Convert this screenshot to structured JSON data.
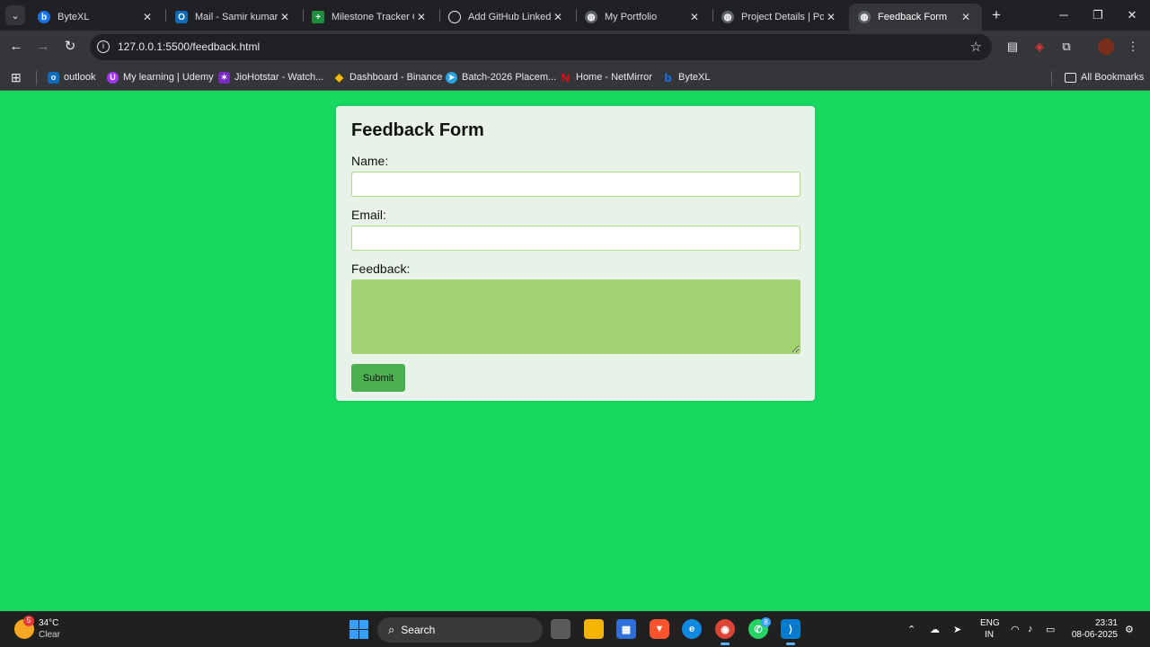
{
  "browser": {
    "tabs": [
      {
        "title": "ByteXL",
        "icon": "bytexl-icon",
        "active": false
      },
      {
        "title": "Mail - Samir kumar -",
        "icon": "outlook-icon",
        "active": false
      },
      {
        "title": "Milestone Tracker CU",
        "icon": "sheets-icon",
        "active": false
      },
      {
        "title": "Add GitHub LinkedIn",
        "icon": "openai-icon",
        "active": false
      },
      {
        "title": "My Portfolio",
        "icon": "globe-icon",
        "active": false
      },
      {
        "title": "Project Details | Portf",
        "icon": "globe-icon",
        "active": false
      },
      {
        "title": "Feedback Form",
        "icon": "globe-icon",
        "active": true
      }
    ],
    "url": "127.0.0.1:5500/feedback.html",
    "bookmarks": [
      {
        "label": "outlook"
      },
      {
        "label": "My learning | Udemy"
      },
      {
        "label": "JioHotstar - Watch..."
      },
      {
        "label": "Dashboard - Binance"
      },
      {
        "label": "Batch-2026 Placem..."
      },
      {
        "label": "Home - NetMirror"
      },
      {
        "label": "ByteXL"
      }
    ],
    "all_bookmarks": "All Bookmarks"
  },
  "page": {
    "background_color": "#18d960",
    "form": {
      "title": "Feedback Form",
      "name_label": "Name:",
      "name_value": "",
      "email_label": "Email:",
      "email_value": "",
      "feedback_label": "Feedback:",
      "feedback_value": "",
      "submit_label": "Submit"
    }
  },
  "taskbar": {
    "weather": {
      "temp": "34°C",
      "condition": "Clear",
      "badge": "5"
    },
    "search_label": "Search",
    "whatsapp_badge": "8",
    "language": {
      "line1": "ENG",
      "line2": "IN"
    },
    "time": "23:31",
    "date": "08-06-2025"
  }
}
